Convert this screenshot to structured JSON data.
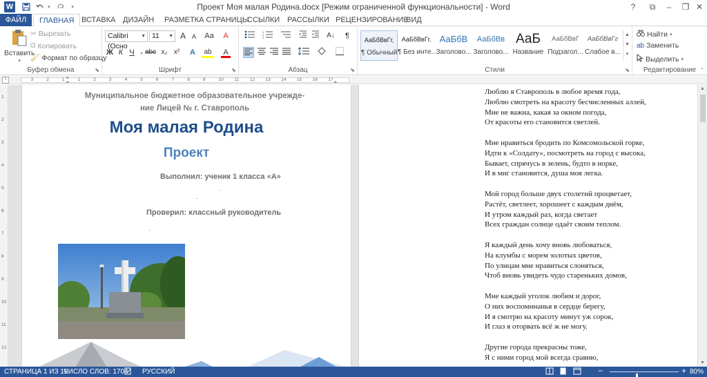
{
  "window": {
    "title": "Проект Моя малая Родина.docx [Режим ограниченной функциональности] - Word",
    "minimize": "–",
    "restore": "❐",
    "close": "✕",
    "help": "?",
    "ribbon_display": "⧉"
  },
  "quick_access": {
    "logo": "W",
    "save_icon": "save-icon",
    "undo_icon": "undo-icon",
    "redo_icon": "redo-icon",
    "customize_icon": "customize-icon"
  },
  "tabs": [
    "ФАЙЛ",
    "ГЛАВНАЯ",
    "ВСТАВКА",
    "ДИЗАЙН",
    "РАЗМЕТКА СТРАНИЦЫ",
    "ССЫЛКИ",
    "РАССЫЛКИ",
    "РЕЦЕНЗИРОВАНИЕ",
    "ВИД"
  ],
  "active_tab": "ГЛАВНАЯ",
  "ribbon": {
    "clipboard": {
      "label": "Буфер обмена",
      "paste": "Вставить",
      "cut": "Вырезать",
      "copy": "Копировать",
      "format_painter": "Формат по образцу"
    },
    "font": {
      "label": "Шрифт",
      "font_name": "Calibri (Осно",
      "font_size": "11",
      "grow": "A",
      "shrink": "A",
      "case": "Aa",
      "clear": "A",
      "bold": "Ж",
      "italic": "К",
      "underline": "Ч",
      "strike": "abc",
      "subscript": "x₂",
      "superscript": "x²",
      "effects": "A",
      "highlight": "ab",
      "color": "A"
    },
    "paragraph": {
      "label": "Абзац"
    },
    "styles": {
      "label": "Стили",
      "items": [
        {
          "sample": "АаБбВвГг,",
          "name": "¶ Обычный"
        },
        {
          "sample": "АаБбВвГг,",
          "name": "¶ Без инте..."
        },
        {
          "sample": "АаБбВ",
          "name": "Заголово..."
        },
        {
          "sample": "АаБбВв",
          "name": "Заголово..."
        },
        {
          "sample": "АаБ",
          "name": "Название"
        },
        {
          "sample": "АаБбВвГ",
          "name": "Подзагол..."
        },
        {
          "sample": "АаБбВвГг",
          "name": "Слабое в..."
        }
      ]
    },
    "editing": {
      "label": "Редактирование",
      "find": "Найти",
      "replace": "Заменить",
      "select": "Выделить"
    }
  },
  "ruler": {
    "numbers": [
      "3",
      "2",
      "1",
      "1",
      "2",
      "3",
      "4",
      "5",
      "6",
      "7",
      "8",
      "9",
      "10",
      "11",
      "12",
      "13",
      "14",
      "15",
      "16",
      "17"
    ]
  },
  "vruler": {
    "numbers": [
      "1",
      "2",
      "3",
      "4",
      "5",
      "6",
      "7",
      "8",
      "9",
      "10",
      "11",
      "12"
    ]
  },
  "page1": {
    "school_line1": "Муниципальное бюджетное образовательное учрежде-",
    "school_line2": "ние Лицей №        г. Ставрополь",
    "title": "Моя малая Родина",
    "subtitle": "Проект",
    "performed": "Выполнил: ученик 1 класса «А»",
    "checked": "Проверил: классный руководитель"
  },
  "page2": {
    "stanzas": [
      [
        "Люблю я Ставрополь в любое время года,",
        "Люблю смотреть на красоту бесчисленных аллей,",
        "Мне не важна, какая за окном погода,",
        "От красоты его становится светлей."
      ],
      [
        "Мне нравиться бродить по Комсомольской горке,",
        "Идти к «Солдату», посмотреть на город с высока,",
        "Бывает, спрячусь в зелень, будто в норке,",
        "И в миг становится, душа моя легка."
      ],
      [
        "Мой город больше двух столетий процветает,",
        "Растёт, светлеет, хорошеет с каждым днём,",
        "И утром каждый раз, когда светает",
        "Всех граждан солнце одаёт своим теплом."
      ],
      [
        "Я каждый день хочу вновь любоваться,",
        "На клумбы с морем золотых цветов,",
        "По улицам мне нравиться слоняться,",
        "Чтоб вновь увидеть чудо стареньких домов,"
      ],
      [
        "Мне каждый уголок любим и дорог,",
        "О них воспоминанья в сердце берегу,",
        "И я смотрю на красоту минут уж сорок,",
        "И глаз я оторвать всё ж не могу."
      ],
      [
        "Другие города прекрасны тоже,",
        "Я с ними город мой всегда сравню,"
      ]
    ]
  },
  "status": {
    "page": "СТРАНИЦА 1 ИЗ 11",
    "words": "ЧИСЛО СЛОВ: 1704",
    "language": "РУССКИЙ",
    "zoom": "80%",
    "zoom_level": 0.8
  },
  "colors": {
    "accent": "#2b579a",
    "title_blue": "#1f4e8c",
    "subtitle_blue": "#4f81bd"
  }
}
